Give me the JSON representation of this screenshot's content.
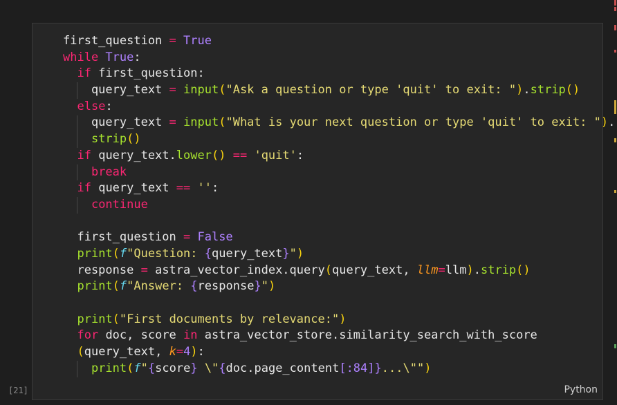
{
  "cell": {
    "execution_count": "[21]",
    "language": "Python"
  },
  "code_lines": [
    [
      {
        "t": "first_question ",
        "c": "id"
      },
      {
        "t": "=",
        "c": "op"
      },
      {
        "t": " True",
        "c": "con"
      }
    ],
    [
      {
        "t": "while",
        "c": "kw"
      },
      {
        "t": " True",
        "c": "con"
      },
      {
        "t": ":",
        "c": "id"
      }
    ],
    [
      {
        "t": "  ",
        "c": "id"
      },
      {
        "t": "if",
        "c": "kw"
      },
      {
        "t": " first_question:",
        "c": "id"
      }
    ],
    [
      {
        "t": "    query_text ",
        "c": "id"
      },
      {
        "t": "=",
        "c": "op"
      },
      {
        "t": " ",
        "c": "id"
      },
      {
        "t": "input",
        "c": "fn"
      },
      {
        "t": "(",
        "c": "br"
      },
      {
        "t": "\"Ask a question or type 'quit' to exit: \"",
        "c": "str"
      },
      {
        "t": ")",
        "c": "br"
      },
      {
        "t": ".",
        "c": "id"
      },
      {
        "t": "strip",
        "c": "fn"
      },
      {
        "t": "()",
        "c": "br"
      }
    ],
    [
      {
        "t": "  ",
        "c": "id"
      },
      {
        "t": "else",
        "c": "kw"
      },
      {
        "t": ":",
        "c": "id"
      }
    ],
    [
      {
        "t": "    query_text ",
        "c": "id"
      },
      {
        "t": "=",
        "c": "op"
      },
      {
        "t": " ",
        "c": "id"
      },
      {
        "t": "input",
        "c": "fn"
      },
      {
        "t": "(",
        "c": "br"
      },
      {
        "t": "\"What is your next question or type 'quit' to exit: \"",
        "c": "str"
      },
      {
        "t": ")",
        "c": "br"
      },
      {
        "t": ".",
        "c": "id"
      }
    ],
    [
      {
        "t": "    ",
        "c": "id"
      },
      {
        "t": "strip",
        "c": "fn"
      },
      {
        "t": "()",
        "c": "br"
      }
    ],
    [
      {
        "t": "  ",
        "c": "id"
      },
      {
        "t": "if",
        "c": "kw"
      },
      {
        "t": " query_text.",
        "c": "id"
      },
      {
        "t": "lower",
        "c": "fn"
      },
      {
        "t": "()",
        "c": "br"
      },
      {
        "t": " ",
        "c": "id"
      },
      {
        "t": "==",
        "c": "op"
      },
      {
        "t": " ",
        "c": "id"
      },
      {
        "t": "'quit'",
        "c": "str"
      },
      {
        "t": ":",
        "c": "id"
      }
    ],
    [
      {
        "t": "    ",
        "c": "id"
      },
      {
        "t": "break",
        "c": "kw"
      }
    ],
    [
      {
        "t": "  ",
        "c": "id"
      },
      {
        "t": "if",
        "c": "kw"
      },
      {
        "t": " query_text ",
        "c": "id"
      },
      {
        "t": "==",
        "c": "op"
      },
      {
        "t": " ",
        "c": "id"
      },
      {
        "t": "''",
        "c": "str"
      },
      {
        "t": ":",
        "c": "id"
      }
    ],
    [
      {
        "t": "    ",
        "c": "id"
      },
      {
        "t": "continue",
        "c": "kw"
      }
    ],
    [],
    [
      {
        "t": "  first_question ",
        "c": "id"
      },
      {
        "t": "=",
        "c": "op"
      },
      {
        "t": " False",
        "c": "con"
      }
    ],
    [
      {
        "t": "  ",
        "c": "id"
      },
      {
        "t": "print",
        "c": "fn"
      },
      {
        "t": "(",
        "c": "br"
      },
      {
        "t": "f",
        "c": "fpre"
      },
      {
        "t": "\"Question: ",
        "c": "str"
      },
      {
        "t": "{",
        "c": "con"
      },
      {
        "t": "query_text",
        "c": "id"
      },
      {
        "t": "}",
        "c": "con"
      },
      {
        "t": "\"",
        "c": "str"
      },
      {
        "t": ")",
        "c": "br"
      }
    ],
    [
      {
        "t": "  response ",
        "c": "id"
      },
      {
        "t": "=",
        "c": "op"
      },
      {
        "t": " astra_vector_index.query",
        "c": "id"
      },
      {
        "t": "(",
        "c": "br"
      },
      {
        "t": "query_text, ",
        "c": "id"
      },
      {
        "t": "llm",
        "c": "pa"
      },
      {
        "t": "=",
        "c": "op"
      },
      {
        "t": "llm",
        "c": "id"
      },
      {
        "t": ")",
        "c": "br"
      },
      {
        "t": ".",
        "c": "id"
      },
      {
        "t": "strip",
        "c": "fn"
      },
      {
        "t": "()",
        "c": "br"
      }
    ],
    [
      {
        "t": "  ",
        "c": "id"
      },
      {
        "t": "print",
        "c": "fn"
      },
      {
        "t": "(",
        "c": "br"
      },
      {
        "t": "f",
        "c": "fpre"
      },
      {
        "t": "\"Answer: ",
        "c": "str"
      },
      {
        "t": "{",
        "c": "con"
      },
      {
        "t": "response",
        "c": "id"
      },
      {
        "t": "}",
        "c": "con"
      },
      {
        "t": "\"",
        "c": "str"
      },
      {
        "t": ")",
        "c": "br"
      }
    ],
    [],
    [
      {
        "t": "  ",
        "c": "id"
      },
      {
        "t": "print",
        "c": "fn"
      },
      {
        "t": "(",
        "c": "br"
      },
      {
        "t": "\"First documents by relevance:\"",
        "c": "str"
      },
      {
        "t": ")",
        "c": "br"
      }
    ],
    [
      {
        "t": "  ",
        "c": "id"
      },
      {
        "t": "for",
        "c": "kw"
      },
      {
        "t": " doc, score ",
        "c": "id"
      },
      {
        "t": "in",
        "c": "kw"
      },
      {
        "t": " astra_vector_store.similarity_search_with_score",
        "c": "id"
      }
    ],
    [
      {
        "t": "  ",
        "c": "id"
      },
      {
        "t": "(",
        "c": "br"
      },
      {
        "t": "query_text, ",
        "c": "id"
      },
      {
        "t": "k",
        "c": "pa"
      },
      {
        "t": "=",
        "c": "op"
      },
      {
        "t": "4",
        "c": "con"
      },
      {
        "t": ")",
        "c": "br"
      },
      {
        "t": ":",
        "c": "id"
      }
    ],
    [
      {
        "t": "    ",
        "c": "id"
      },
      {
        "t": "print",
        "c": "fn"
      },
      {
        "t": "(",
        "c": "br"
      },
      {
        "t": "f",
        "c": "fpre"
      },
      {
        "t": "\"",
        "c": "str"
      },
      {
        "t": "{",
        "c": "con"
      },
      {
        "t": "score",
        "c": "id"
      },
      {
        "t": "}",
        "c": "con"
      },
      {
        "t": " \\\"",
        "c": "str"
      },
      {
        "t": "{",
        "c": "con"
      },
      {
        "t": "doc.page_content",
        "c": "id"
      },
      {
        "t": "[",
        "c": "con"
      },
      {
        "t": ":84",
        "c": "con"
      },
      {
        "t": "]",
        "c": "con"
      },
      {
        "t": "}",
        "c": "con"
      },
      {
        "t": "...\\\"\"",
        "c": "str"
      },
      {
        "t": ")",
        "c": "br"
      }
    ]
  ],
  "colors": {
    "keyword": "#f92672",
    "constant": "#ae81ff",
    "function": "#a6e22e",
    "string": "#e6db74",
    "parameter": "#fd971f"
  }
}
